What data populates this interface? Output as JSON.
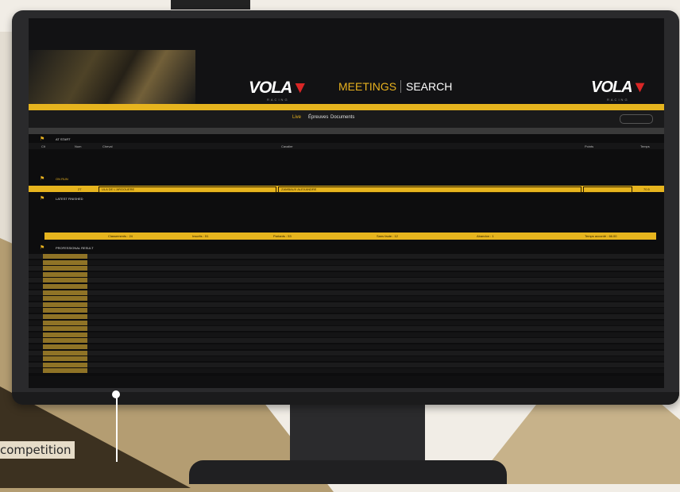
{
  "header": {
    "logo_text": "VOLA",
    "logo_sub": "RACING",
    "nav_meetings": "MEETINGS",
    "nav_search": "SEARCH",
    "right_text": "",
    "gold_bar_text": ""
  },
  "tabs": [
    "Live",
    "Épreuves",
    "Documents"
  ],
  "refresh_label": "",
  "info_bar": "",
  "sections": {
    "start": "AT START",
    "on_run": "ON RUN",
    "latest": "LATEST FINISHED",
    "results": "PROFESSIONAL RESULT"
  },
  "columns": [
    "Clt",
    "Num",
    "Cheval",
    "Cavalier",
    "Points",
    "Temps"
  ],
  "highlight_row": {
    "num": "27",
    "horse": "ULA DE L'ARGOUERE",
    "rider": "ZAMBAUX ALEXANDRE",
    "points": "",
    "time": "70.5"
  },
  "latest_rows": [
    {
      "rank": "",
      "num": "",
      "horse": "",
      "rider": "",
      "points": "",
      "time": ""
    },
    {
      "rank": "",
      "num": "",
      "horse": "",
      "rider": "",
      "points": "",
      "time": ""
    }
  ],
  "stats": [
    "Classements : 24",
    "Inscrits : 51",
    "Partants : 53",
    "Sans faute : 12",
    "Abandon : 1",
    "Temps accordé : 66.00"
  ],
  "results": [
    {
      "num": "",
      "horse": "",
      "rider": ""
    },
    {
      "num": "",
      "horse": "",
      "rider": ""
    },
    {
      "num": "",
      "horse": "",
      "rider": ""
    },
    {
      "num": "",
      "horse": "",
      "rider": ""
    },
    {
      "num": "",
      "horse": "",
      "rider": ""
    },
    {
      "num": "",
      "horse": "",
      "rider": ""
    },
    {
      "num": "",
      "horse": "",
      "rider": ""
    },
    {
      "num": "",
      "horse": "",
      "rider": ""
    },
    {
      "num": "",
      "horse": "",
      "rider": ""
    },
    {
      "num": "",
      "horse": "",
      "rider": ""
    },
    {
      "num": "",
      "horse": "",
      "rider": ""
    },
    {
      "num": "",
      "horse": "",
      "rider": ""
    },
    {
      "num": "",
      "horse": "",
      "rider": ""
    },
    {
      "num": "",
      "horse": "",
      "rider": ""
    },
    {
      "num": "",
      "horse": "",
      "rider": ""
    },
    {
      "num": "",
      "horse": "",
      "rider": ""
    },
    {
      "num": "",
      "horse": "",
      "rider": ""
    },
    {
      "num": "",
      "horse": "",
      "rider": ""
    },
    {
      "num": "",
      "horse": "",
      "rider": ""
    },
    {
      "num": "",
      "horse": "",
      "rider": ""
    }
  ],
  "footer_text": "",
  "caption": "competition",
  "colors": {
    "accent": "#e6b41e",
    "background": "#0d0d0e",
    "logo_red": "#d92626"
  }
}
